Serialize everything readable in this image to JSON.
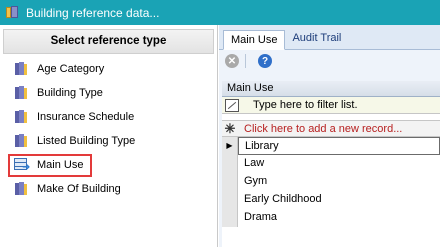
{
  "window": {
    "title": "Building reference data..."
  },
  "left_panel": {
    "header": "Select reference type",
    "items": [
      {
        "label": "Age Category",
        "icon": "books-icon",
        "selected": false
      },
      {
        "label": "Building Type",
        "icon": "books-icon",
        "selected": false
      },
      {
        "label": "Insurance Schedule",
        "icon": "books-icon",
        "selected": false
      },
      {
        "label": "Listed Building Type",
        "icon": "books-icon",
        "selected": false
      },
      {
        "label": "Main Use",
        "icon": "table-edit-icon",
        "selected": true
      },
      {
        "label": "Make Of Building",
        "icon": "books-icon",
        "selected": false
      }
    ],
    "highlight_color": "#e33a3a"
  },
  "tabs": [
    {
      "label": "Main Use",
      "active": true
    },
    {
      "label": "Audit Trail",
      "active": false
    }
  ],
  "grid": {
    "column_header": "Main Use",
    "filter_placeholder": "Type here to filter list.",
    "add_row_text": "Click here to add a new record...",
    "rows": [
      "Library",
      "Law",
      "Gym",
      "Early Childhood",
      "Drama"
    ]
  },
  "colors": {
    "titlebar": "#1aa3b5",
    "add_row_text": "#b72020"
  }
}
